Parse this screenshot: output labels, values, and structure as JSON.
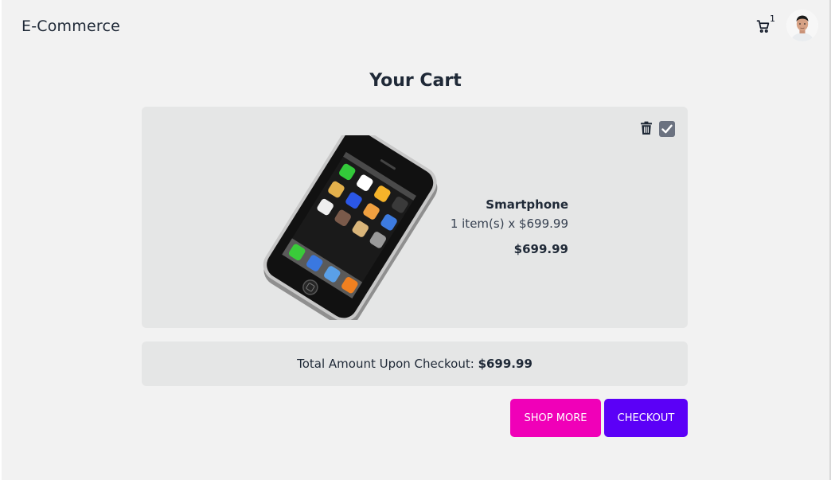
{
  "navbar": {
    "brand": "E-Commerce",
    "cart_count": "1"
  },
  "page": {
    "title": "Your Cart"
  },
  "cart": {
    "items": [
      {
        "name": "Smartphone",
        "quantity_line": "1 item(s) x $699.99",
        "subtotal": "$699.99",
        "selected": true
      }
    ],
    "total_label": "Total Amount Upon Checkout:",
    "total_value": "$699.99"
  },
  "actions": {
    "shop_more": "SHOP MORE",
    "checkout": "CHECKOUT"
  },
  "colors": {
    "background": "#f2f2f2",
    "card": "#e5e6e6",
    "shop_more": "#f000b8",
    "checkout": "#5b00f7",
    "checkbox": "#6b7280"
  }
}
